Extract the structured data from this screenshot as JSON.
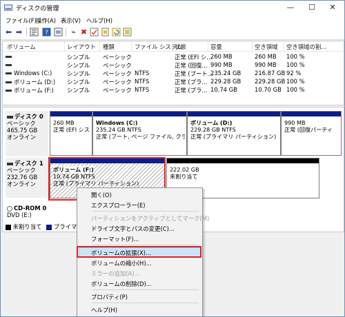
{
  "window": {
    "title": "ディスクの管理"
  },
  "menubar": [
    "ファイル(F)",
    "操作(A)",
    "表示(V)",
    "ヘルプ(H)"
  ],
  "listview": {
    "columns": [
      "ボリューム",
      "レイアウト",
      "種類",
      "ファイル システム",
      "状態",
      "容量",
      "空き領域",
      "空き領域の割..."
    ],
    "rows": [
      [
        "",
        "シンプル",
        "ベーシック",
        "",
        "正常 (EFI シ...",
        "260 MB",
        "260 MB",
        "100 %"
      ],
      [
        "",
        "シンプル",
        "ベーシック",
        "",
        "正常 (回復...",
        "990 MB",
        "990 MB",
        "100 %"
      ],
      [
        "Windows (C:)",
        "シンプル",
        "ベーシック",
        "NTFS",
        "正常 (ブート...",
        "235.24 GB",
        "216.87 GB",
        "92 %"
      ],
      [
        "ボリューム (D:)",
        "シンプル",
        "ベーシック",
        "NTFS",
        "正常 (プラ...",
        "229.28 GB",
        "229.28 GB",
        "100 %"
      ],
      [
        "ボリューム (F:)",
        "シンプル",
        "ベーシック",
        "NTFS",
        "正常 (プラ...",
        "10.74 GB",
        "10.70 GB",
        "100 %"
      ]
    ]
  },
  "disks": [
    {
      "name": "ディスク 0",
      "type": "ベーシック",
      "size": "465.75 GB",
      "status": "オンライン",
      "partitions": [
        {
          "title": "",
          "line1": "260 MB",
          "line2": "正常 (EFI システ"
        },
        {
          "title": "Windows  (C:)",
          "line1": "235.24 GB NTFS",
          "line2": "正常 (ブート, ページ ファイル, クラッシュ ダ"
        },
        {
          "title": "ボリューム  (D:)",
          "line1": "229.28 GB NTFS",
          "line2": "正常 (プライマリ パーティション)"
        },
        {
          "title": "",
          "line1": "990 MB",
          "line2": "正常 (回復パーティ"
        }
      ]
    },
    {
      "name": "ディスク 1",
      "type": "ベーシック",
      "size": "232.76 GB",
      "status": "オンライン",
      "partitions": [
        {
          "title": "ボリューム  (F:)",
          "line1": "10.74 GB NTFS",
          "line2": "正常 (プライマリ パーティション)"
        },
        {
          "title": "",
          "line1": "222.02 GB",
          "line2": "未割り当て"
        }
      ]
    },
    {
      "name": "CD-ROM 0",
      "type": "DVD (E:)"
    }
  ],
  "legend": {
    "unallocated": "未割り当て",
    "primary": "プライマリ パー"
  },
  "context_menu": {
    "items": [
      {
        "label": "開く(O)",
        "enabled": true
      },
      {
        "label": "エクスプローラー(E)",
        "enabled": true
      },
      {
        "label": "パーティションをアクティブとしてマーク(M)",
        "enabled": false
      },
      {
        "label": "ドライブ文字とパスの変更(C)...",
        "enabled": true
      },
      {
        "label": "フォーマット(F)...",
        "enabled": true
      },
      {
        "label": "ボリュームの拡張(X)...",
        "enabled": true,
        "highlighted": true
      },
      {
        "label": "ボリュームの縮小(H)...",
        "enabled": true
      },
      {
        "label": "ミラーの追加(A)...",
        "enabled": false
      },
      {
        "label": "ボリュームの削除(D)...",
        "enabled": true
      },
      {
        "label": "プロパティ(P)",
        "enabled": true
      },
      {
        "label": "ヘルプ(H)",
        "enabled": true
      }
    ]
  },
  "colors": {
    "primary_partition": "#0a1e8c",
    "unallocated": "#000000",
    "highlight_box": "#e02020",
    "menu_highlight": "#cce4f7"
  },
  "icons": [
    "disk-management-icon",
    "back-arrow-icon",
    "forward-arrow-icon",
    "properties-icon",
    "help-icon",
    "connect-icon",
    "delete-icon",
    "check-icon",
    "refresh-icon",
    "disk-icon",
    "cdrom-icon"
  ]
}
